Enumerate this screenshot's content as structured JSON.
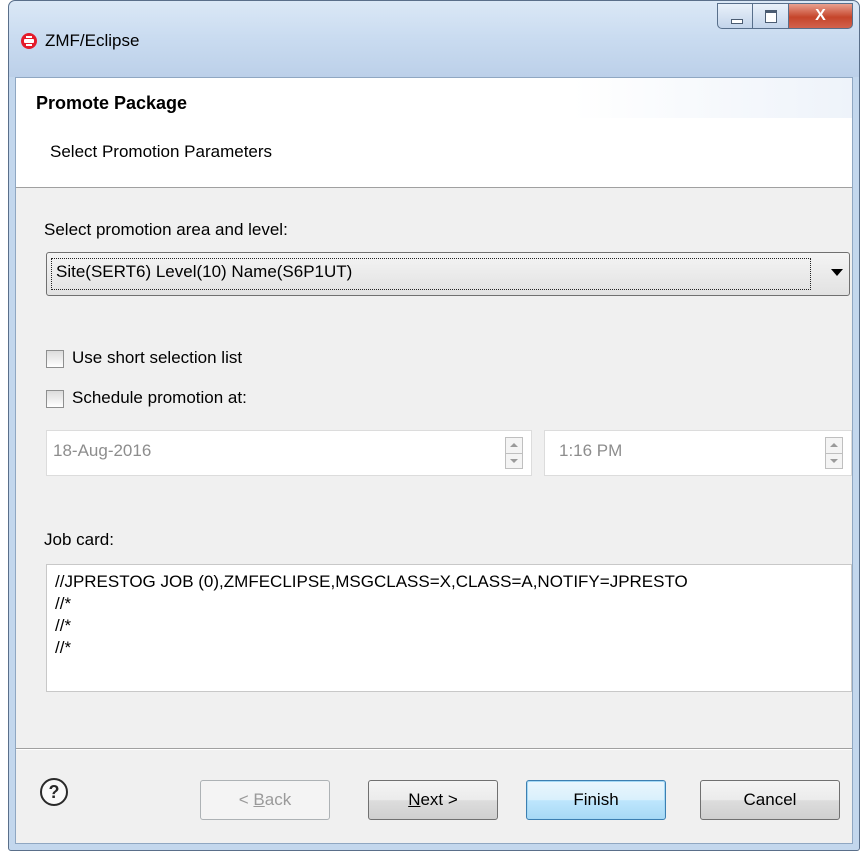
{
  "window": {
    "title": "ZMF/Eclipse",
    "close_glyph": "X"
  },
  "wizard": {
    "title": "Promote Package",
    "description": "Select Promotion Parameters"
  },
  "promotion": {
    "label": "Select promotion area and level:",
    "selected": "Site(SERT6) Level(10) Name(S6P1UT)"
  },
  "options": {
    "short_list_label": "Use short selection list",
    "short_list_checked": false,
    "schedule_label": "Schedule promotion at:",
    "schedule_checked": false
  },
  "schedule": {
    "date": "18-Aug-2016",
    "time": "1:16 PM"
  },
  "jobcard": {
    "label": "Job card:",
    "text": "//JPRESTOG JOB (0),ZMFECLIPSE,MSGCLASS=X,CLASS=A,NOTIFY=JPRESTO\n//*\n//*\n//*"
  },
  "buttons": {
    "help_glyph": "?",
    "back_prefix": "< ",
    "back_mnemonic": "B",
    "back_rest": "ack",
    "next_mnemonic": "N",
    "next_rest": "ext >",
    "finish": "Finish",
    "cancel": "Cancel"
  },
  "icons": {
    "app": "zmf-app-icon",
    "help": "help-icon",
    "dropdown": "chevron-down-icon"
  },
  "colors": {
    "title_bar": "#c9dbf0",
    "close_button": "#c5452b",
    "dialog_bg": "#f0f0f0",
    "default_button": "#3c7fb1"
  }
}
